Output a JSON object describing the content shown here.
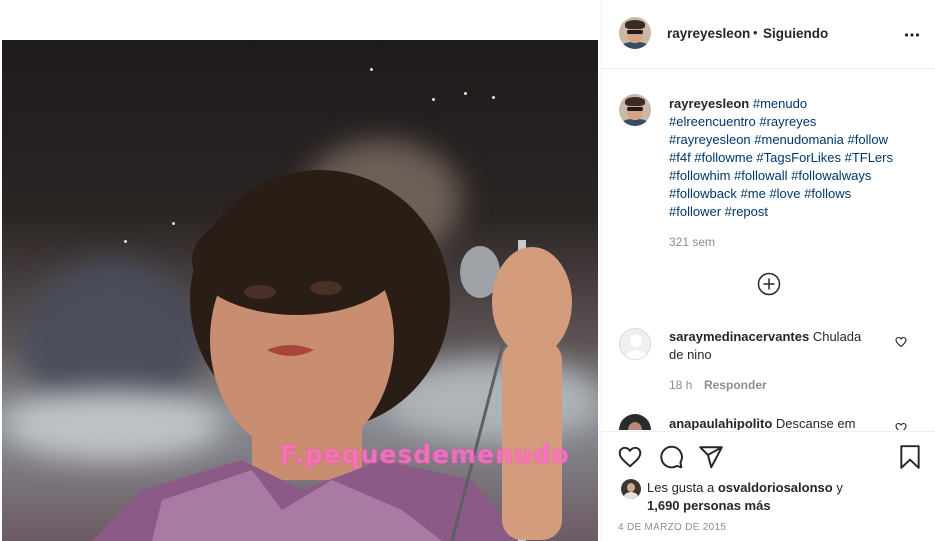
{
  "post": {
    "author": "rayreyesleon",
    "separator": "•",
    "follow_status": "Siguiendo",
    "options_icon": "more-horizontal-icon",
    "photo_watermark": "F.pequesdemenudo"
  },
  "caption": {
    "author": "rayreyesleon",
    "hashtags_line1": "#menudo",
    "hashtags_line2": "#elreencuentro #rayreyes",
    "hashtags_line3": "#rayreyesleon #menudomania #follow",
    "hashtags_line4": "#f4f #followme #TagsForLikes #TFLers",
    "hashtags_line5": "#followhim #followall #followalways",
    "hashtags_line6": "#followback #me #love #follows",
    "hashtags_line7": "#follower #repost",
    "age": "321 sem"
  },
  "load_more_icon": "plus-circle-icon",
  "comments": [
    {
      "author": "saraymedinacervantes",
      "text_part1": "Chulada",
      "text_part2": "de nino",
      "age": "18 h",
      "reply_label": "Responder"
    },
    {
      "author": "anapaulahipolito",
      "text_part1": "Descanse em"
    }
  ],
  "actions": {
    "icons": [
      "heart-icon",
      "comment-icon",
      "share-icon",
      "bookmark-icon"
    ]
  },
  "likes": {
    "prefix": "Les gusta a",
    "user": "osvaldoriosalonso",
    "joiner": "y",
    "count_text": "1,690 personas más"
  },
  "date": "4 DE MARZO DE 2015",
  "colors": {
    "hashtag": "#00376b",
    "text": "#262626",
    "muted": "#8e8e8e",
    "border": "#efefef",
    "watermark": "#ff6ec7"
  }
}
